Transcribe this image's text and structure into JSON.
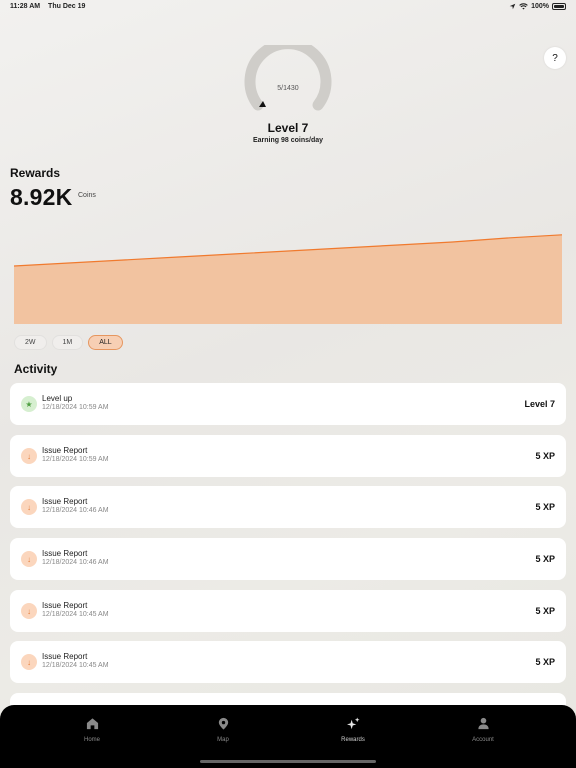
{
  "status_bar": {
    "time": "11:28 AM",
    "date": "Thu Dec 19",
    "battery": "100%"
  },
  "help": {
    "label": "?"
  },
  "gauge": {
    "progress_text": "5/1430",
    "progress_fraction": 0.0035
  },
  "level": {
    "title": "Level 7",
    "subtitle": "Earning 98 coins/day"
  },
  "rewards": {
    "title": "Rewards",
    "value": "8.92K",
    "unit": "Coins"
  },
  "chart_data": {
    "type": "area",
    "x": [
      0,
      1,
      2,
      3,
      4,
      5,
      6,
      7,
      8,
      9,
      10
    ],
    "values": [
      5.8,
      6.1,
      6.4,
      6.7,
      7.0,
      7.3,
      7.6,
      7.9,
      8.2,
      8.6,
      8.92
    ],
    "ylim": [
      0,
      10
    ],
    "grid": false,
    "legend": "none",
    "line_color": "#f07a2e",
    "fill_color": "#f2c3a0"
  },
  "range_tabs": [
    {
      "label": "2W",
      "active": false
    },
    {
      "label": "1M",
      "active": false
    },
    {
      "label": "ALL",
      "active": true
    }
  ],
  "activity": {
    "title": "Activity",
    "items": [
      {
        "icon": "star-icon",
        "name": "Level up",
        "time": "12/18/2024 10:59 AM",
        "value": "Level 7"
      },
      {
        "icon": "arrow-down-icon",
        "name": "Issue Report",
        "time": "12/18/2024 10:59 AM",
        "value": "5 XP"
      },
      {
        "icon": "arrow-down-icon",
        "name": "Issue Report",
        "time": "12/18/2024 10:46 AM",
        "value": "5 XP"
      },
      {
        "icon": "arrow-down-icon",
        "name": "Issue Report",
        "time": "12/18/2024 10:46 AM",
        "value": "5 XP"
      },
      {
        "icon": "arrow-down-icon",
        "name": "Issue Report",
        "time": "12/18/2024 10:45 AM",
        "value": "5 XP"
      },
      {
        "icon": "arrow-down-icon",
        "name": "Issue Report",
        "time": "12/18/2024 10:45 AM",
        "value": "5 XP"
      }
    ]
  },
  "tab_bar": [
    {
      "label": "Home",
      "icon": "home-icon",
      "active": false
    },
    {
      "label": "Map",
      "icon": "map-pin-icon",
      "active": false
    },
    {
      "label": "Rewards",
      "icon": "sparkles-icon",
      "active": true
    },
    {
      "label": "Account",
      "icon": "person-icon",
      "active": false
    }
  ],
  "colors": {
    "accent": "#f07a2e",
    "accent_fill": "#f2c3a0",
    "tab_bar_bg": "#000000"
  }
}
